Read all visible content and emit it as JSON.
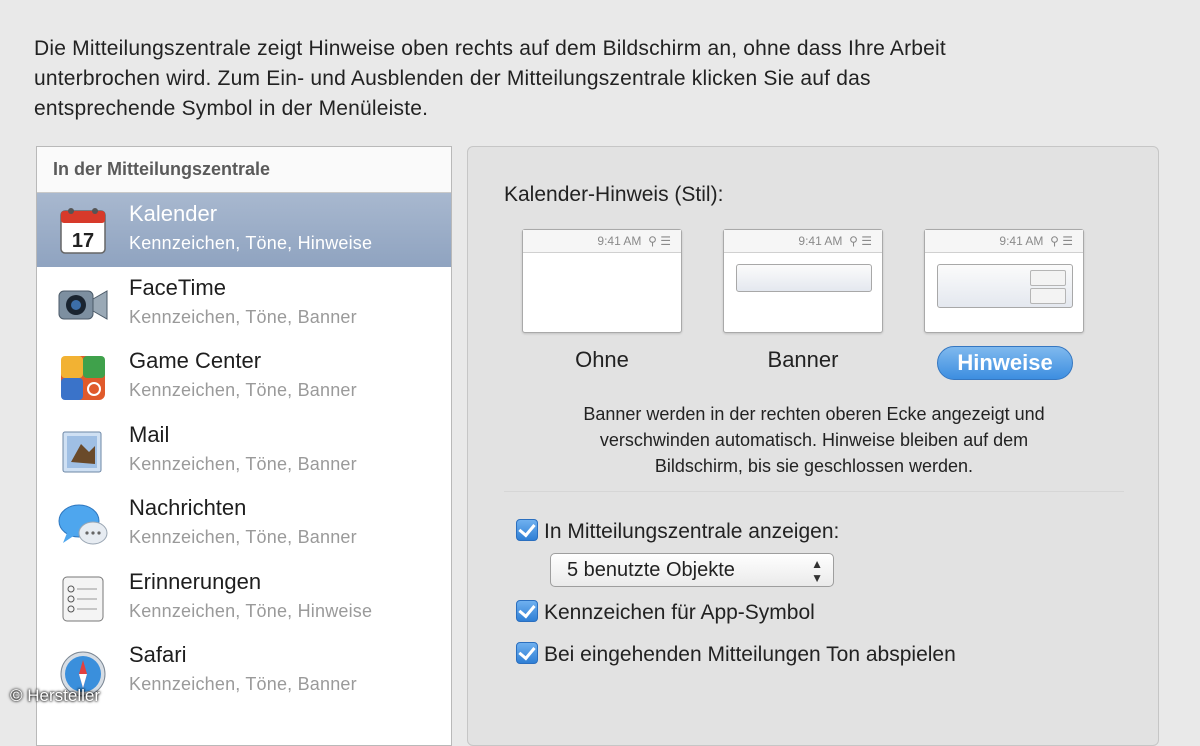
{
  "intro": {
    "line1": "Die Mitteilungszentrale zeigt Hinweise oben rechts auf dem Bildschirm an, ohne dass Ihre Arbeit",
    "line2": "unterbrochen wird. Zum Ein- und Ausblenden der Mitteilungszentrale klicken Sie auf das",
    "line3": "entsprechende Symbol in der Menüleiste."
  },
  "list": {
    "header": "In der Mitteilungszentrale",
    "items": [
      {
        "name": "Kalender",
        "sub": "Kennzeichen, Töne, Hinweise",
        "icon": "calendar-icon",
        "calendar_day": "17",
        "selected": true
      },
      {
        "name": "FaceTime",
        "sub": "Kennzeichen, Töne, Banner",
        "icon": "facetime-icon"
      },
      {
        "name": "Game Center",
        "sub": "Kennzeichen, Töne, Banner",
        "icon": "game-center-icon"
      },
      {
        "name": "Mail",
        "sub": "Kennzeichen, Töne, Banner",
        "icon": "mail-icon"
      },
      {
        "name": "Nachrichten",
        "sub": "Kennzeichen, Töne, Banner",
        "icon": "messages-icon"
      },
      {
        "name": "Erinnerungen",
        "sub": "Kennzeichen, Töne, Hinweise",
        "icon": "reminders-icon"
      },
      {
        "name": "Safari",
        "sub": "Kennzeichen, Töne, Banner",
        "icon": "safari-icon"
      }
    ]
  },
  "panel": {
    "style_title": "Kalender-Hinweis (Stil):",
    "preview_time": "9:41 AM",
    "styles": [
      {
        "label": "Ohne",
        "selected": false
      },
      {
        "label": "Banner",
        "selected": false
      },
      {
        "label": "Hinweise",
        "selected": true
      }
    ],
    "description": {
      "line1": "Banner werden in der rechten oberen Ecke angezeigt und",
      "line2": "verschwinden automatisch. Hinweise bleiben auf dem",
      "line3": "Bildschirm, bis sie geschlossen werden."
    },
    "show_in_center": {
      "label": "In Mitteilungszentrale anzeigen:",
      "checked": true
    },
    "items_select": {
      "value": "5 benutzte Objekte"
    },
    "badge": {
      "label": "Kennzeichen für App-Symbol",
      "checked": true
    },
    "sound": {
      "label": "Bei eingehenden Mitteilungen Ton abspielen",
      "checked": true
    }
  },
  "credit": "© Hersteller",
  "colors": {
    "accent": "#3d8ee0",
    "selection": "#8fa3c0"
  }
}
